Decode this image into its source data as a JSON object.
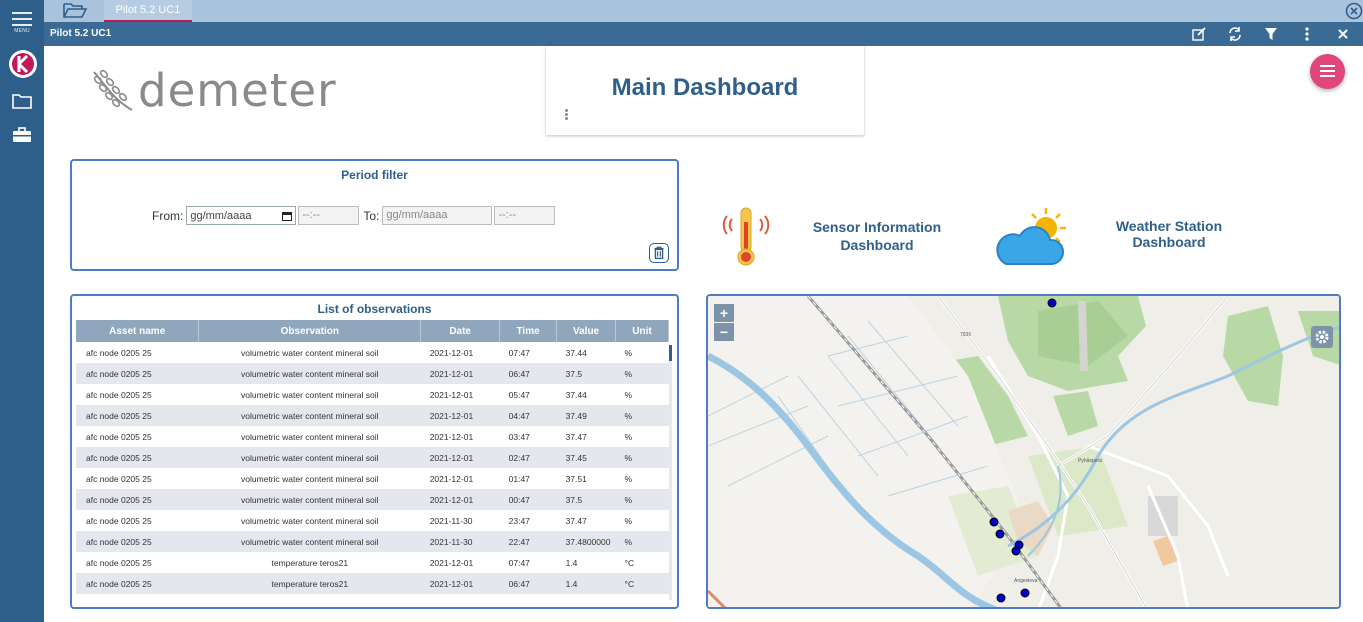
{
  "rail": {
    "menu_label": "MENU"
  },
  "tabbar": {
    "active_tab": "Pilot 5.2 UC1"
  },
  "titlebar": {
    "title": "Pilot 5.2 UC1"
  },
  "logo": {
    "word": "demeter"
  },
  "dashboard": {
    "title": "Main Dashboard"
  },
  "period_filter": {
    "title": "Period filter",
    "from_label": "From:",
    "to_label": "To:",
    "from_date_placeholder": "gg/mm/aaaa",
    "from_time_placeholder": "--:--",
    "to_date_placeholder": "gg/mm/aaaa",
    "to_time_placeholder": "--:--"
  },
  "observations": {
    "title": "List of observations",
    "columns": [
      "Asset name",
      "Observation",
      "Date",
      "Time",
      "Value",
      "Unit"
    ],
    "rows": [
      [
        "afc node 0205 25",
        "volumetric water content mineral soil",
        "2021-12-01",
        "07:47",
        "37.44",
        "%"
      ],
      [
        "afc node 0205 25",
        "volumetric water content mineral soil",
        "2021-12-01",
        "06:47",
        "37.5",
        "%"
      ],
      [
        "afc node 0205 25",
        "volumetric water content mineral soil",
        "2021-12-01",
        "05:47",
        "37.44",
        "%"
      ],
      [
        "afc node 0205 25",
        "volumetric water content mineral soil",
        "2021-12-01",
        "04:47",
        "37.49",
        "%"
      ],
      [
        "afc node 0205 25",
        "volumetric water content mineral soil",
        "2021-12-01",
        "03:47",
        "37.47",
        "%"
      ],
      [
        "afc node 0205 25",
        "volumetric water content mineral soil",
        "2021-12-01",
        "02:47",
        "37.45",
        "%"
      ],
      [
        "afc node 0205 25",
        "volumetric water content mineral soil",
        "2021-12-01",
        "01:47",
        "37.51",
        "%"
      ],
      [
        "afc node 0205 25",
        "volumetric water content mineral soil",
        "2021-12-01",
        "00:47",
        "37.5",
        "%"
      ],
      [
        "afc node 0205 25",
        "volumetric water content mineral soil",
        "2021-11-30",
        "23:47",
        "37.47",
        "%"
      ],
      [
        "afc node 0205 25",
        "volumetric water content mineral soil",
        "2021-11-30",
        "22:47",
        "37.4800000",
        "%"
      ],
      [
        "afc node 0205 25",
        "temperature teros21",
        "2021-12-01",
        "07:47",
        "1.4",
        "°C"
      ],
      [
        "afc node 0205 25",
        "temperature teros21",
        "2021-12-01",
        "06:47",
        "1.4",
        "°C"
      ]
    ]
  },
  "quick_links": {
    "sensor": "Sensor Information Dashboard",
    "weather": "Weather Station Dashboard"
  },
  "map": {
    "zoom_in": "+",
    "zoom_out": "−",
    "labels": {
      "road_number": "7836",
      "village_1": "Pyhäsperä",
      "village_2": "Angesleva"
    }
  },
  "colors": {
    "rail": "#2e5f8a",
    "accent": "#e0457b",
    "panel_border": "#4f7cc5",
    "title_text": "#2f5f8a"
  }
}
